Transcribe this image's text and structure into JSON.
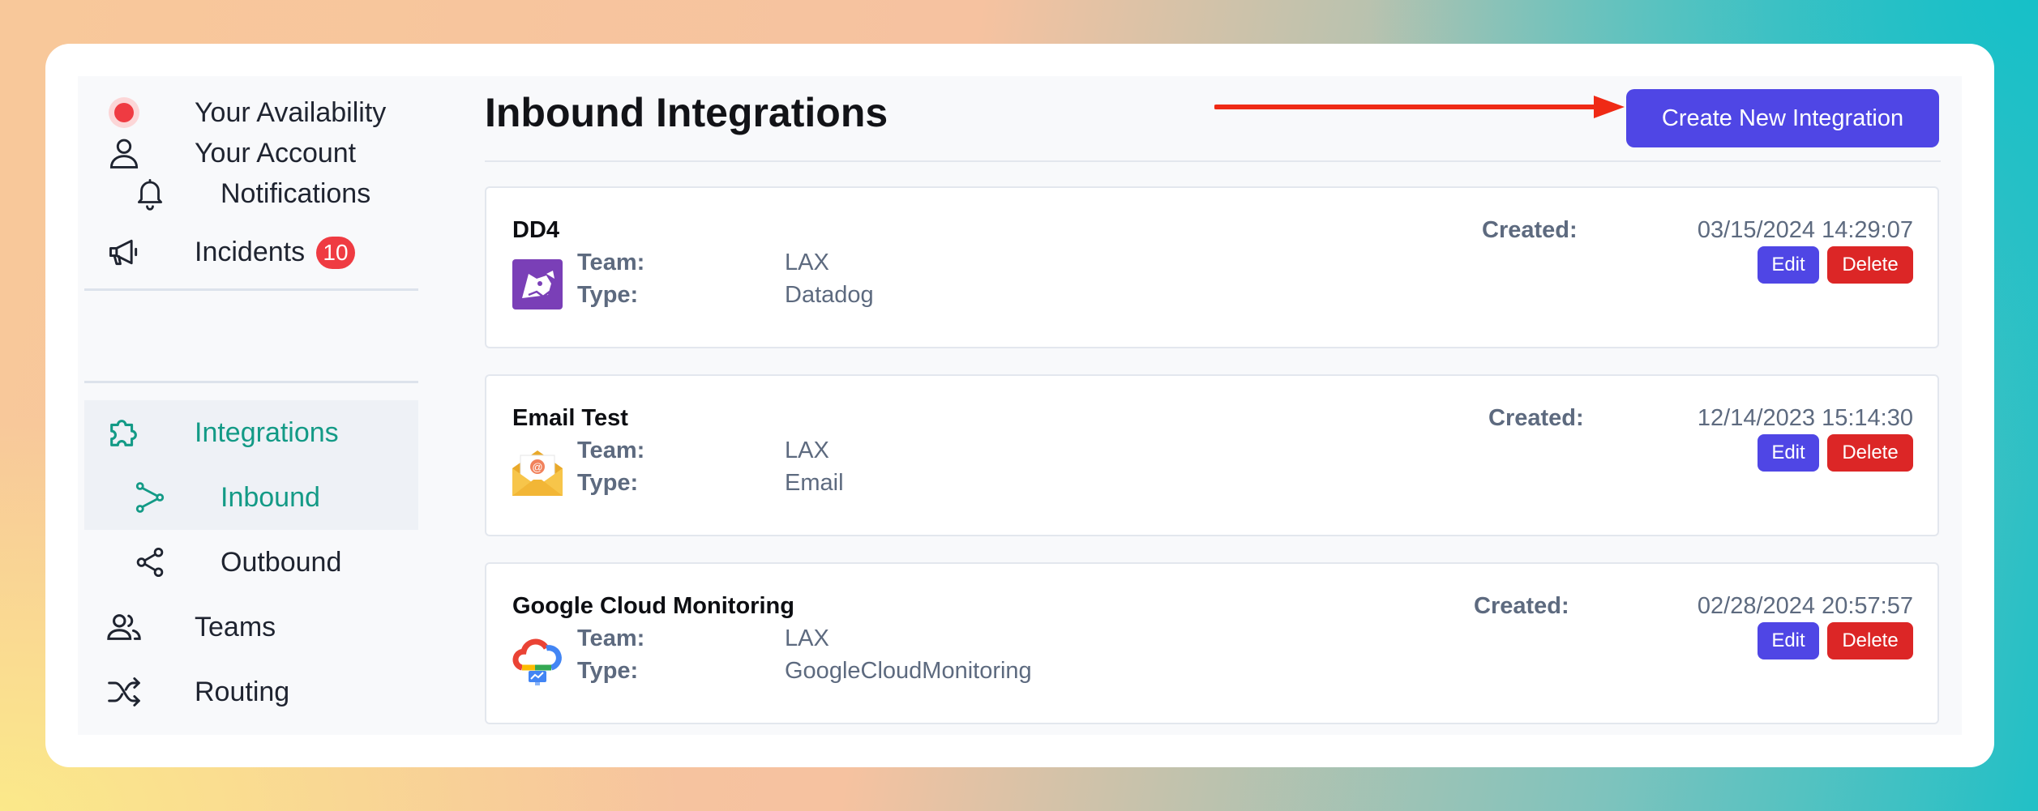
{
  "sidebar": {
    "availability": {
      "label": "Your Availability",
      "status_color": "#ef3b42"
    },
    "account": {
      "label": "Your Account",
      "icon": "user-icon"
    },
    "notifications": {
      "label": "Notifications",
      "icon": "bell-icon"
    },
    "incidents": {
      "label": "Incidents",
      "icon": "megaphone-icon",
      "badge": "10"
    },
    "integrations": {
      "label": "Integrations",
      "icon": "puzzle-icon"
    },
    "inbound": {
      "label": "Inbound",
      "icon": "inbound-branch-icon"
    },
    "outbound": {
      "label": "Outbound",
      "icon": "share-icon"
    },
    "teams": {
      "label": "Teams",
      "icon": "users-icon"
    },
    "routing": {
      "label": "Routing",
      "icon": "shuffle-icon"
    }
  },
  "main": {
    "title": "Inbound Integrations",
    "create_button": "Create New Integration",
    "colors": {
      "accent": "#4f46e5",
      "danger": "#dc2626",
      "active": "#139a86"
    },
    "integrations": [
      {
        "name": "DD4",
        "team_label": "Team:",
        "team": "LAX",
        "type_label": "Type:",
        "type": "Datadog",
        "created_label": "Created:",
        "created": "03/15/2024 14:29:07",
        "edit": "Edit",
        "delete": "Delete",
        "logo": "datadog-logo-icon"
      },
      {
        "name": "Email Test",
        "team_label": "Team:",
        "team": "LAX",
        "type_label": "Type:",
        "type": "Email",
        "created_label": "Created:",
        "created": "12/14/2023 15:14:30",
        "edit": "Edit",
        "delete": "Delete",
        "logo": "email-envelope-icon"
      },
      {
        "name": "Google Cloud Monitoring",
        "team_label": "Team:",
        "team": "LAX",
        "type_label": "Type:",
        "type": "GoogleCloudMonitoring",
        "created_label": "Created:",
        "created": "02/28/2024 20:57:57",
        "edit": "Edit",
        "delete": "Delete",
        "logo": "google-cloud-monitoring-icon"
      }
    ]
  }
}
